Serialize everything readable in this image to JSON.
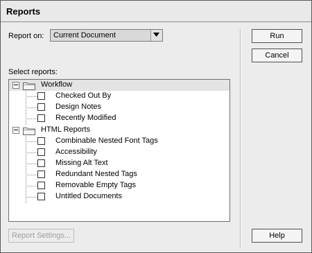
{
  "dialog": {
    "title": "Reports",
    "report_on_label": "Report on:",
    "report_on_value": "Current Document",
    "select_reports_label": "Select reports:",
    "buttons": {
      "run": "Run",
      "cancel": "Cancel",
      "help": "Help",
      "report_settings": "Report Settings..."
    }
  },
  "tree": {
    "groups": [
      {
        "label": "Workflow",
        "items": [
          "Checked Out By",
          "Design Notes",
          "Recently Modified"
        ]
      },
      {
        "label": "HTML Reports",
        "items": [
          "Combinable Nested Font Tags",
          "Accessibility",
          "Missing Alt Text",
          "Redundant Nested Tags",
          "Removable Empty Tags",
          "Untitled Documents"
        ]
      }
    ]
  },
  "icons": {
    "dropdown": "chevron-down-icon",
    "expander": "minus-box-icon",
    "folder": "folder-icon",
    "checkbox": "checkbox-icon"
  }
}
